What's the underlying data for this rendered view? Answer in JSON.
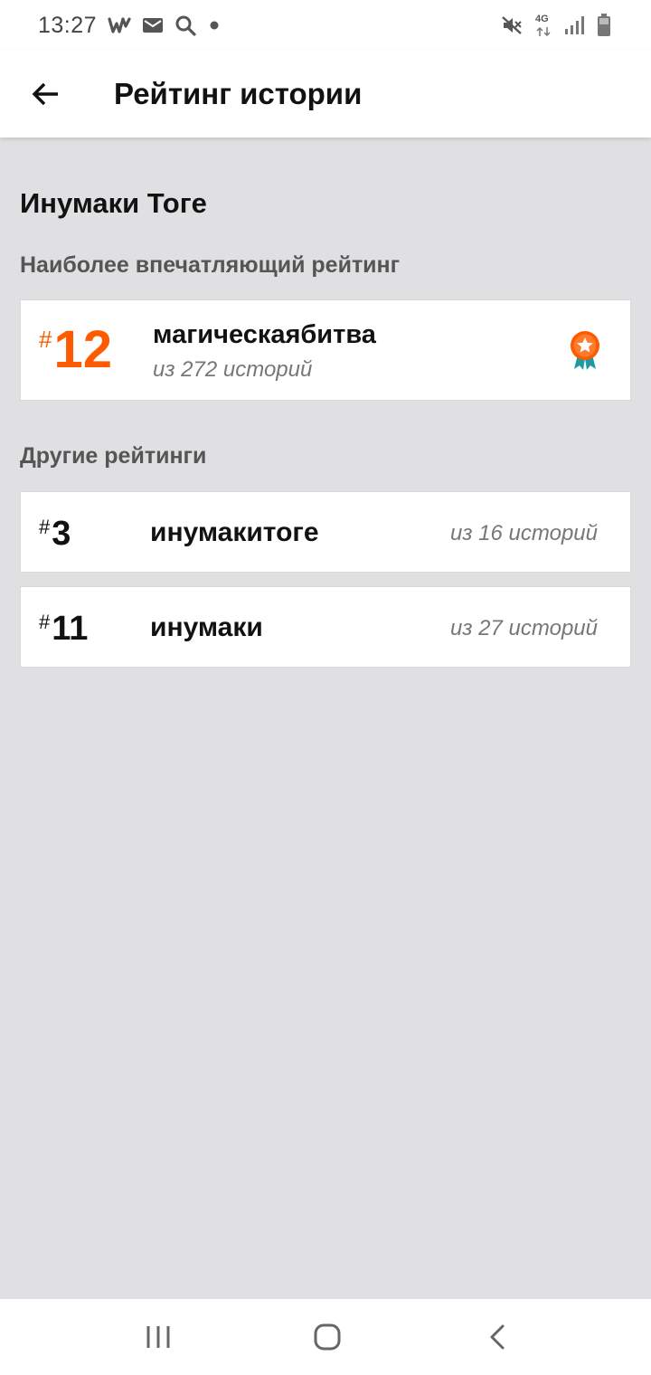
{
  "status_bar": {
    "time": "13:27",
    "left_icons": [
      "wattpad-icon",
      "mail-icon",
      "search-icon",
      "dot-icon"
    ],
    "right_icons": [
      "mute-icon",
      "network-4g-icon",
      "signal-icon",
      "battery-icon"
    ],
    "network_label": "4G"
  },
  "app_bar": {
    "title": "Рейтинг истории",
    "back_icon": "arrow-left-icon"
  },
  "story": {
    "title": "Инумаки Тоге"
  },
  "best_ranking": {
    "section_label": "Наиболее впечатляющий рейтинг",
    "hash": "#",
    "rank": "12",
    "tag": "магическаябитва",
    "subtitle": "из 272 историй",
    "icon": "medal-icon",
    "accent_color": "#ff5a00"
  },
  "other_rankings": {
    "section_label": "Другие рейтинги",
    "items": [
      {
        "hash": "#",
        "rank": "3",
        "tag": "инумакитоге",
        "subtitle": "из 16 историй"
      },
      {
        "hash": "#",
        "rank": "11",
        "tag": "инумаки",
        "subtitle": "из 27 историй"
      }
    ]
  },
  "nav_bar": {
    "icons": [
      "recent-apps-icon",
      "home-icon",
      "back-icon"
    ]
  }
}
